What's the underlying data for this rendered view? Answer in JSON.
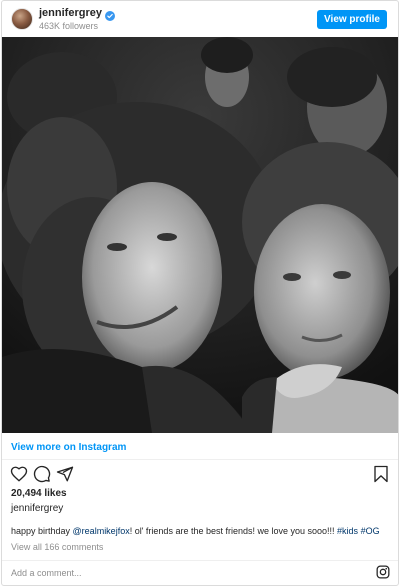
{
  "header": {
    "username": "jennifergrey",
    "followers": "463K followers",
    "view_profile_label": "View profile",
    "verified_icon": "verified-badge-icon",
    "verified_color": "#3897f0"
  },
  "photo": {
    "description_icon": "photo-image",
    "tone": "black-and-white"
  },
  "view_more_label": "View more on Instagram",
  "actions": {
    "like_icon": "heart-icon",
    "comment_icon": "comment-icon",
    "share_icon": "share-icon",
    "save_icon": "bookmark-icon"
  },
  "likes": "20,494 likes",
  "owner": "jennifergrey",
  "caption": {
    "prefix": "happy birthday ",
    "mention": "@realmikejfox",
    "middle": "! ol' friends are the best friends! we love you sooo!!! ",
    "tag1": "#kids",
    "space": " ",
    "tag2": "#OG"
  },
  "view_all_comments": "View all 166 comments",
  "comment_placeholder": "Add a comment...",
  "colors": {
    "accent": "#0095f6",
    "link": "#00376b",
    "muted": "#8e8e8e"
  }
}
